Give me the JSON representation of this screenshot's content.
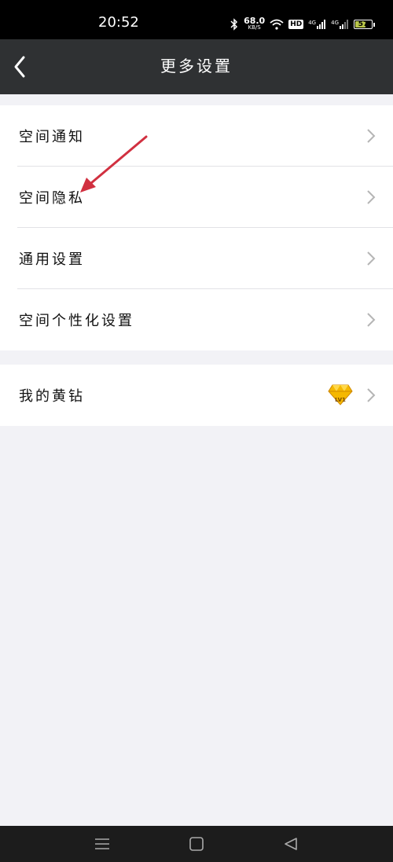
{
  "status_bar": {
    "time": "20:52",
    "net_speed_value": "68.0",
    "net_speed_unit": "KB/S",
    "hd_label": "HD",
    "signal1_label": "4G",
    "signal2_label": "4G",
    "battery_level": "57"
  },
  "header": {
    "title": "更多设置"
  },
  "settings_group": {
    "items": [
      {
        "label": "空间通知"
      },
      {
        "label": "空间隐私"
      },
      {
        "label": "通用设置"
      },
      {
        "label": "空间个性化设置"
      }
    ]
  },
  "vip_group": {
    "label": "我的黄钻",
    "badge_text": "LV1"
  },
  "colors": {
    "navbar_bg": "#2f3133",
    "page_bg": "#f2f2f6",
    "annotation_arrow": "#d13040",
    "diamond_gold": "#f5b800"
  }
}
